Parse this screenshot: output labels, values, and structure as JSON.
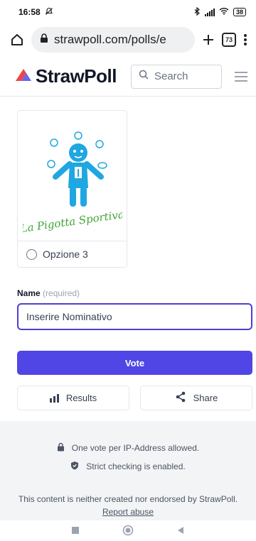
{
  "status_bar": {
    "time": "16:58",
    "battery": "38"
  },
  "browser": {
    "url": "strawpoll.com/polls/e",
    "tab_count": "73"
  },
  "site": {
    "logo_text": "StrawPoll",
    "search_placeholder": "Search"
  },
  "poll": {
    "option_image_text": "La Pigotta Sportiva",
    "option_label": "Opzione 3"
  },
  "form": {
    "name_label": "Name",
    "name_required": "(required)",
    "name_value": "Inserire Nominativo",
    "vote_label": "Vote",
    "results_label": "Results",
    "share_label": "Share"
  },
  "footer": {
    "ip_notice": "One vote per IP-Address allowed.",
    "strict_notice": "Strict checking is enabled.",
    "disclaimer": "This content is neither created nor endorsed by StrawPoll.",
    "report_link": "Report abuse"
  },
  "colors": {
    "accent": "#5046e5",
    "logo_red": "#ef4444",
    "logo_purple": "#6366f1",
    "doll_blue": "#1ea7e1"
  }
}
